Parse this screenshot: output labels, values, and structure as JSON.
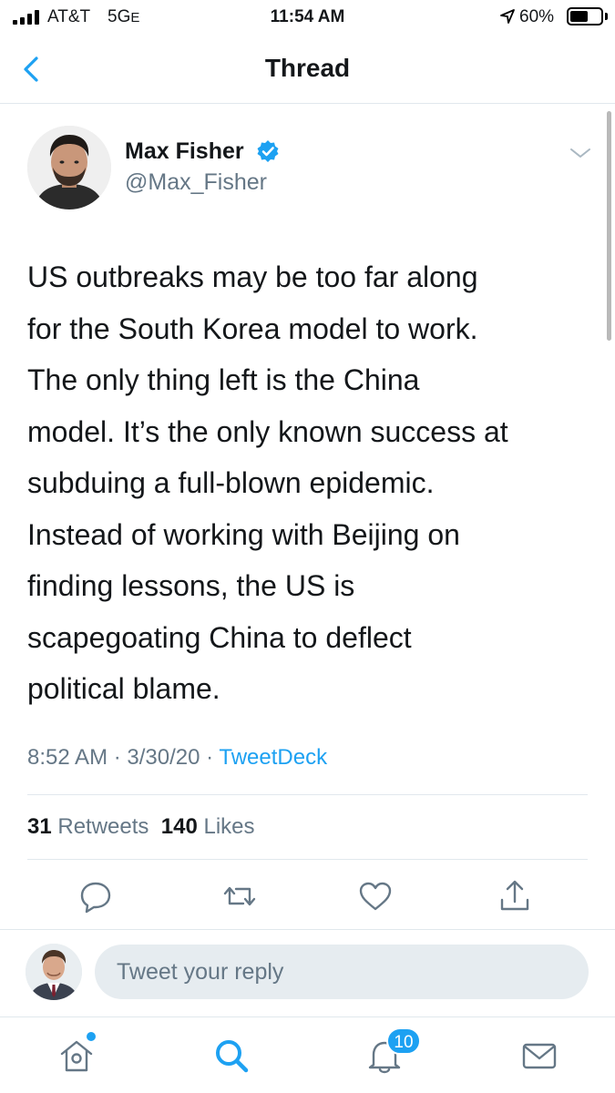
{
  "status_bar": {
    "carrier": "AT&T",
    "network": "5G",
    "network_suffix": "E",
    "time": "11:54 AM",
    "battery": "60%",
    "battery_level": 0.6
  },
  "nav": {
    "title": "Thread",
    "back_icon": "chevron-left-icon"
  },
  "tweet": {
    "author_name": "Max Fisher",
    "author_handle": "@Max_Fisher",
    "verified": true,
    "text_lines": [
      "US outbreaks may be too far along",
      "for the South Korea model to work.",
      "The only thing left is the China",
      "model. It’s the only known success at",
      "subduing a full-blown epidemic.",
      "Instead of working with Beijing on",
      "finding lessons, the US is",
      "scapegoating China to deflect",
      "political blame."
    ],
    "time": "8:52 AM",
    "date": "3/30/20",
    "source": "TweetDeck",
    "retweets_count": "31",
    "retweets_label": "Retweets",
    "likes_count": "140",
    "likes_label": "Likes"
  },
  "actions": [
    "reply-icon",
    "retweet-icon",
    "like-icon",
    "share-icon"
  ],
  "reply": {
    "placeholder": "Tweet your reply"
  },
  "tab_bar": {
    "items": [
      "home-icon",
      "search-icon",
      "notifications-icon",
      "messages-icon"
    ],
    "notifications_badge": "10"
  },
  "colors": {
    "accent": "#1da1f2",
    "secondary_text": "#657786",
    "divider": "#e1e8ed"
  }
}
